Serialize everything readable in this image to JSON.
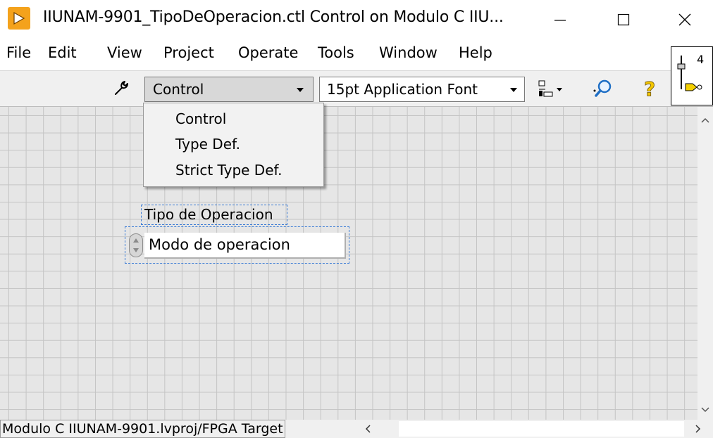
{
  "window": {
    "title": "IIUNAM-9901_TipoDeOperacion.ctl Control on Modulo C IIU...",
    "icon": "labview-control-icon",
    "buttons": [
      "minimize-icon",
      "maximize-icon",
      "close-icon"
    ]
  },
  "menubar": {
    "items": [
      "File",
      "Edit",
      "View",
      "Project",
      "Operate",
      "Tools",
      "Window",
      "Help"
    ]
  },
  "toolbar": {
    "wrench_icon": "wrench-icon",
    "control_type": "Control",
    "font": "15pt Application Font",
    "align_icon": "align-objects-icon",
    "zoom_icon": "zoom-icon",
    "help_icon": "context-help-icon",
    "vi_icon_text": "4"
  },
  "dropdown": {
    "items": [
      "Control",
      "Type Def.",
      "Strict Type Def."
    ]
  },
  "control": {
    "label": "Tipo de Operacion",
    "value": "Modo de operacion"
  },
  "statusbar": {
    "path": "Modulo C IIUNAM-9901.lvproj/FPGA Target"
  },
  "colors": {
    "accent": "#f4a21c",
    "selection_dash": "#3a7bd5",
    "panel_bg": "#e6e6e6",
    "grid": "#c4c4c4"
  }
}
